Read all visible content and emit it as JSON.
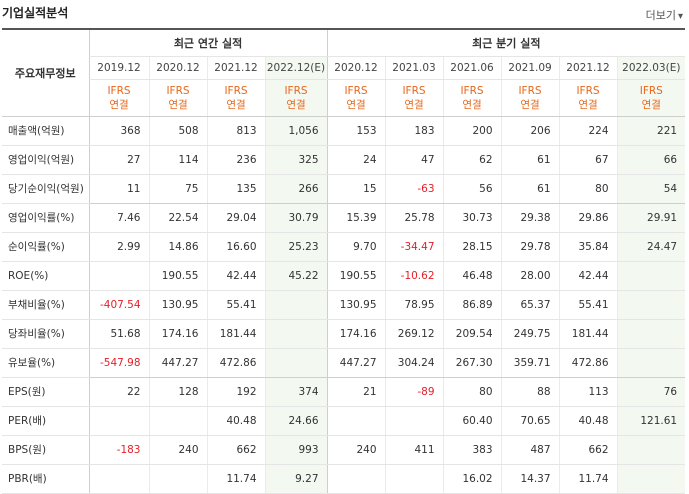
{
  "header": {
    "title": "기업실적분석",
    "more_label": "더보기",
    "more_arrow": "▾"
  },
  "table": {
    "corner_label": "주요재무정보",
    "groups": [
      "최근 연간 실적",
      "최근 분기 실적"
    ],
    "periods": [
      "2019.12",
      "2020.12",
      "2021.12",
      "2022.12(E)",
      "2020.12",
      "2021.03",
      "2021.06",
      "2021.09",
      "2021.12",
      "2022.03(E)"
    ],
    "std_top": "IFRS",
    "std_bottom": "연결",
    "rows": [
      {
        "label": "매출액(억원)",
        "values": [
          "368",
          "508",
          "813",
          "1,056",
          "153",
          "183",
          "200",
          "206",
          "224",
          "221"
        ]
      },
      {
        "label": "영업이익(억원)",
        "values": [
          "27",
          "114",
          "236",
          "325",
          "24",
          "47",
          "62",
          "61",
          "67",
          "66"
        ]
      },
      {
        "label": "당기순이익(억원)",
        "values": [
          "11",
          "75",
          "135",
          "266",
          "15",
          "-63",
          "56",
          "61",
          "80",
          "54"
        ]
      },
      {
        "label": "영업이익률(%)",
        "values": [
          "7.46",
          "22.54",
          "29.04",
          "30.79",
          "15.39",
          "25.78",
          "30.73",
          "29.38",
          "29.86",
          "29.91"
        ]
      },
      {
        "label": "순이익률(%)",
        "values": [
          "2.99",
          "14.86",
          "16.60",
          "25.23",
          "9.70",
          "-34.47",
          "28.15",
          "29.78",
          "35.84",
          "24.47"
        ]
      },
      {
        "label": "ROE(%)",
        "values": [
          "",
          "190.55",
          "42.44",
          "45.22",
          "190.55",
          "-10.62",
          "46.48",
          "28.00",
          "42.44",
          ""
        ]
      },
      {
        "label": "부채비율(%)",
        "values": [
          "-407.54",
          "130.95",
          "55.41",
          "",
          "130.95",
          "78.95",
          "86.89",
          "65.37",
          "55.41",
          ""
        ]
      },
      {
        "label": "당좌비율(%)",
        "values": [
          "51.68",
          "174.16",
          "181.44",
          "",
          "174.16",
          "269.12",
          "209.54",
          "249.75",
          "181.44",
          ""
        ]
      },
      {
        "label": "유보율(%)",
        "values": [
          "-547.98",
          "447.27",
          "472.86",
          "",
          "447.27",
          "304.24",
          "267.30",
          "359.71",
          "472.86",
          ""
        ]
      },
      {
        "label": "EPS(원)",
        "values": [
          "22",
          "128",
          "192",
          "374",
          "21",
          "-89",
          "80",
          "88",
          "113",
          "76"
        ]
      },
      {
        "label": "PER(배)",
        "values": [
          "",
          "",
          "40.48",
          "24.66",
          "",
          "",
          "60.40",
          "70.65",
          "40.48",
          "121.61"
        ]
      },
      {
        "label": "BPS(원)",
        "values": [
          "-183",
          "240",
          "662",
          "993",
          "240",
          "411",
          "383",
          "487",
          "662",
          ""
        ]
      },
      {
        "label": "PBR(배)",
        "values": [
          "",
          "",
          "11.74",
          "9.27",
          "",
          "",
          "16.02",
          "14.37",
          "11.74",
          ""
        ]
      }
    ]
  }
}
